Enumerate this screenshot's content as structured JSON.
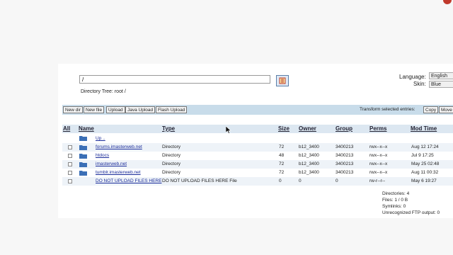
{
  "path_field": {
    "value": "/"
  },
  "directory_tree": "Directory Tree: root /",
  "language": {
    "label": "Language:",
    "value": "English"
  },
  "skin": {
    "label": "Skin:",
    "value": "Blue"
  },
  "toolbar": {
    "buttons": [
      "New dir",
      "New file",
      "Upload",
      "Java Upload",
      "Flash Upload"
    ],
    "transform_label": "Transform selected entries:",
    "transform_buttons": [
      "Copy",
      "Move"
    ]
  },
  "columns": [
    "All",
    "Name",
    "Type",
    "Size",
    "Owner",
    "Group",
    "Perms",
    "Mod Time"
  ],
  "up_label": "Up ..",
  "rows": [
    {
      "name": "forums.imasterweb.net",
      "type": "Directory",
      "size": "72",
      "owner": "b12_3400",
      "group": "3400213",
      "perms": "rwx--x--x",
      "mod": "Aug 12 17:24"
    },
    {
      "name": "htdocs",
      "type": "Directory",
      "size": "48",
      "owner": "b12_3400",
      "group": "3400213",
      "perms": "rwx--x--x",
      "mod": "Jul 9 17:25"
    },
    {
      "name": "imasterweb.net",
      "type": "Directory",
      "size": "72",
      "owner": "b12_3400",
      "group": "3400213",
      "perms": "rwx--x--x",
      "mod": "May 25 02:48"
    },
    {
      "name": "tumblr.imasterweb.net",
      "type": "Directory",
      "size": "72",
      "owner": "b12_3400",
      "group": "3400213",
      "perms": "rwx--x--x",
      "mod": "Aug 11 00:32"
    },
    {
      "name": "DO NOT UPLOAD FILES HERE",
      "type": "DO NOT UPLOAD FILES HERE File",
      "size": "0",
      "owner": "0",
      "group": "0",
      "perms": "rw-r--r--",
      "mod": "May 6 19:27"
    }
  ],
  "summary": {
    "directories": "Directories: 4",
    "files": "Files: 1 / 0 B",
    "symlinks": "Symlinks: 0",
    "unrecognized": "Unrecognized FTP output: 0"
  },
  "colors": {
    "toolbar_bg": "#c8dcea",
    "header_bg": "#dce7f1",
    "link": "#1a2c9a",
    "folder": "#3b6fb6"
  }
}
